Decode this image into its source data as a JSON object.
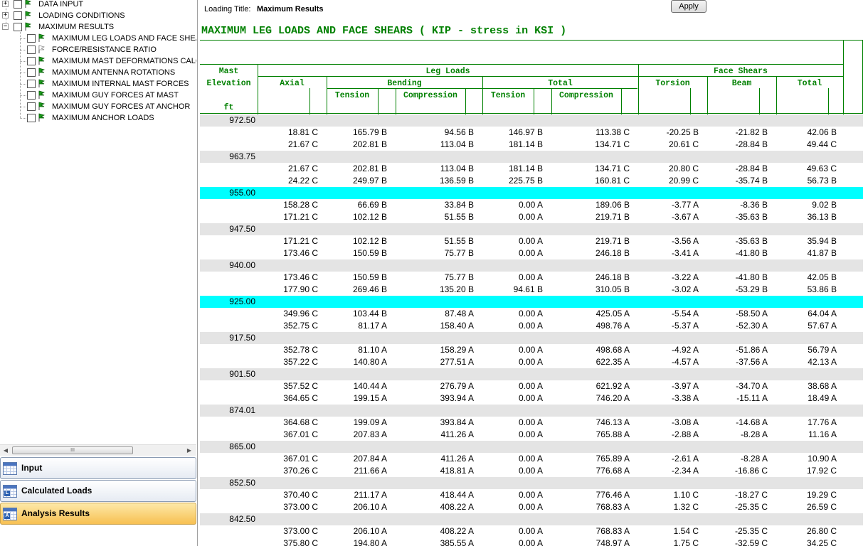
{
  "tree": {
    "top_items": [
      {
        "label": "DATA INPUT",
        "expander": "+"
      },
      {
        "label": "LOADING CONDITIONS",
        "expander": "+"
      },
      {
        "label": "MAXIMUM RESULTS",
        "expander": "−"
      }
    ],
    "children": [
      {
        "label": "MAXIMUM LEG LOADS AND FACE SHEAR",
        "flag": "green"
      },
      {
        "label": "FORCE/RESISTANCE RATIO",
        "flag": "white"
      },
      {
        "label": "MAXIMUM MAST DEFORMATIONS CALCUI",
        "flag": "green"
      },
      {
        "label": "MAXIMUM ANTENNA ROTATIONS",
        "flag": "green"
      },
      {
        "label": "MAXIMUM INTERNAL MAST FORCES",
        "flag": "green"
      },
      {
        "label": "MAXIMUM GUY FORCES AT MAST",
        "flag": "green"
      },
      {
        "label": "MAXIMUM GUY FORCES AT ANCHOR",
        "flag": "green"
      },
      {
        "label": "MAXIMUM ANCHOR LOADS",
        "flag": "green"
      }
    ]
  },
  "scrollbar": {
    "thumb_grip": "III"
  },
  "nav": {
    "input": "Input",
    "calculated": "Calculated Loads",
    "analysis": "Analysis Results",
    "input_icon_letter": "",
    "calculated_icon_letter": "L",
    "analysis_icon_letter": "A"
  },
  "header": {
    "loading_title_label": "Loading Title:",
    "loading_title_value": "Maximum Results",
    "apply_label": "Apply"
  },
  "report": {
    "title": "MAXIMUM LEG LOADS AND FACE SHEARS ( KIP - stress in KSI )",
    "columns": {
      "mast": "Mast",
      "elevation": "Elevation",
      "ft": "ft",
      "leg_loads": "Leg Loads",
      "face_shears": "Face Shears",
      "axial": "Axial",
      "bending": "Bending",
      "total": "Total",
      "torsion": "Torsion",
      "beam": "Beam",
      "total2": "Total",
      "tension": "Tension",
      "compression": "Compression",
      "tension2": "Tension",
      "compression2": "Compression"
    },
    "sections": [
      {
        "elevation": "972.50",
        "highlight": false,
        "rows": [
          [
            "18.81 C",
            "165.79 B",
            "94.56 B",
            "146.97 B",
            "113.38 C",
            "-20.25 B",
            "-21.82 B",
            "42.06 B"
          ],
          [
            "21.67 C",
            "202.81 B",
            "113.04 B",
            "181.14 B",
            "134.71 C",
            "20.61 C",
            "-28.84 B",
            "49.44 C"
          ]
        ]
      },
      {
        "elevation": "963.75",
        "highlight": false,
        "rows": [
          [
            "21.67 C",
            "202.81 B",
            "113.04 B",
            "181.14 B",
            "134.71 C",
            "20.80 C",
            "-28.84 B",
            "49.63 C"
          ],
          [
            "24.22 C",
            "249.97 B",
            "136.59 B",
            "225.75 B",
            "160.81 C",
            "20.99 C",
            "-35.74 B",
            "56.73 B"
          ]
        ]
      },
      {
        "elevation": "955.00",
        "highlight": true,
        "rows": [
          [
            "158.28 C",
            "66.69 B",
            "33.84 B",
            "0.00 A",
            "189.06 B",
            "-3.77 A",
            "-8.36 B",
            "9.02 B"
          ],
          [
            "171.21 C",
            "102.12 B",
            "51.55 B",
            "0.00 A",
            "219.71 B",
            "-3.67 A",
            "-35.63 B",
            "36.13 B"
          ]
        ]
      },
      {
        "elevation": "947.50",
        "highlight": false,
        "rows": [
          [
            "171.21 C",
            "102.12 B",
            "51.55 B",
            "0.00 A",
            "219.71 B",
            "-3.56 A",
            "-35.63 B",
            "35.94 B"
          ],
          [
            "173.46 C",
            "150.59 B",
            "75.77 B",
            "0.00 A",
            "246.18 B",
            "-3.41 A",
            "-41.80 B",
            "41.87 B"
          ]
        ]
      },
      {
        "elevation": "940.00",
        "highlight": false,
        "rows": [
          [
            "173.46 C",
            "150.59 B",
            "75.77 B",
            "0.00 A",
            "246.18 B",
            "-3.22 A",
            "-41.80 B",
            "42.05 B"
          ],
          [
            "177.90 C",
            "269.46 B",
            "135.20 B",
            "94.61 B",
            "310.05 B",
            "-3.02 A",
            "-53.29 B",
            "53.86 B"
          ]
        ]
      },
      {
        "elevation": "925.00",
        "highlight": true,
        "rows": [
          [
            "349.96 C",
            "103.44 B",
            "87.48 A",
            "0.00 A",
            "425.05 A",
            "-5.54 A",
            "-58.50 A",
            "64.04 A"
          ],
          [
            "352.75 C",
            "81.17 A",
            "158.40 A",
            "0.00 A",
            "498.76 A",
            "-5.37 A",
            "-52.30 A",
            "57.67 A"
          ]
        ]
      },
      {
        "elevation": "917.50",
        "highlight": false,
        "rows": [
          [
            "352.78 C",
            "81.10 A",
            "158.29 A",
            "0.00 A",
            "498.68 A",
            "-4.92 A",
            "-51.86 A",
            "56.79 A"
          ],
          [
            "357.22 C",
            "140.80 A",
            "277.51 A",
            "0.00 A",
            "622.35 A",
            "-4.57 A",
            "-37.56 A",
            "42.13 A"
          ]
        ]
      },
      {
        "elevation": "901.50",
        "highlight": false,
        "rows": [
          [
            "357.52 C",
            "140.44 A",
            "276.79 A",
            "0.00 A",
            "621.92 A",
            "-3.97 A",
            "-34.70 A",
            "38.68 A"
          ],
          [
            "364.65 C",
            "199.15 A",
            "393.94 A",
            "0.00 A",
            "746.20 A",
            "-3.38 A",
            "-15.11 A",
            "18.49 A"
          ]
        ]
      },
      {
        "elevation": "874.01",
        "highlight": false,
        "rows": [
          [
            "364.68 C",
            "199.09 A",
            "393.84 A",
            "0.00 A",
            "746.13 A",
            "-3.08 A",
            "-14.68 A",
            "17.76 A"
          ],
          [
            "367.01 C",
            "207.83 A",
            "411.26 A",
            "0.00 A",
            "765.88 A",
            "-2.88 A",
            "-8.28 A",
            "11.16 A"
          ]
        ]
      },
      {
        "elevation": "865.00",
        "highlight": false,
        "rows": [
          [
            "367.01 C",
            "207.84 A",
            "411.26 A",
            "0.00 A",
            "765.89 A",
            "-2.61 A",
            "-8.28 A",
            "10.90 A"
          ],
          [
            "370.26 C",
            "211.66 A",
            "418.81 A",
            "0.00 A",
            "776.68 A",
            "-2.34 A",
            "-16.86 C",
            "17.92 C"
          ]
        ]
      },
      {
        "elevation": "852.50",
        "highlight": false,
        "rows": [
          [
            "370.40 C",
            "211.17 A",
            "418.44 A",
            "0.00 A",
            "776.46 A",
            "1.10 C",
            "-18.27 C",
            "19.29 C"
          ],
          [
            "373.00 C",
            "206.10 A",
            "408.22 A",
            "0.00 A",
            "768.83 A",
            "1.32 C",
            "-25.35 C",
            "26.59 C"
          ]
        ]
      },
      {
        "elevation": "842.50",
        "highlight": false,
        "rows": [
          [
            "373.00 C",
            "206.10 A",
            "408.22 A",
            "0.00 A",
            "768.83 A",
            "1.54 C",
            "-25.35 C",
            "26.80 C"
          ],
          [
            "375.80 C",
            "194.80 A",
            "385.55 A",
            "0.00 A",
            "748.97 A",
            "1.75 C",
            "-32.59 C",
            "34.25 C"
          ]
        ]
      }
    ]
  },
  "colors": {
    "report_green": "#008000",
    "highlight_row": "#00ffff",
    "elevation_row": "#e4e4e4",
    "active_nav": "#f7c052"
  }
}
